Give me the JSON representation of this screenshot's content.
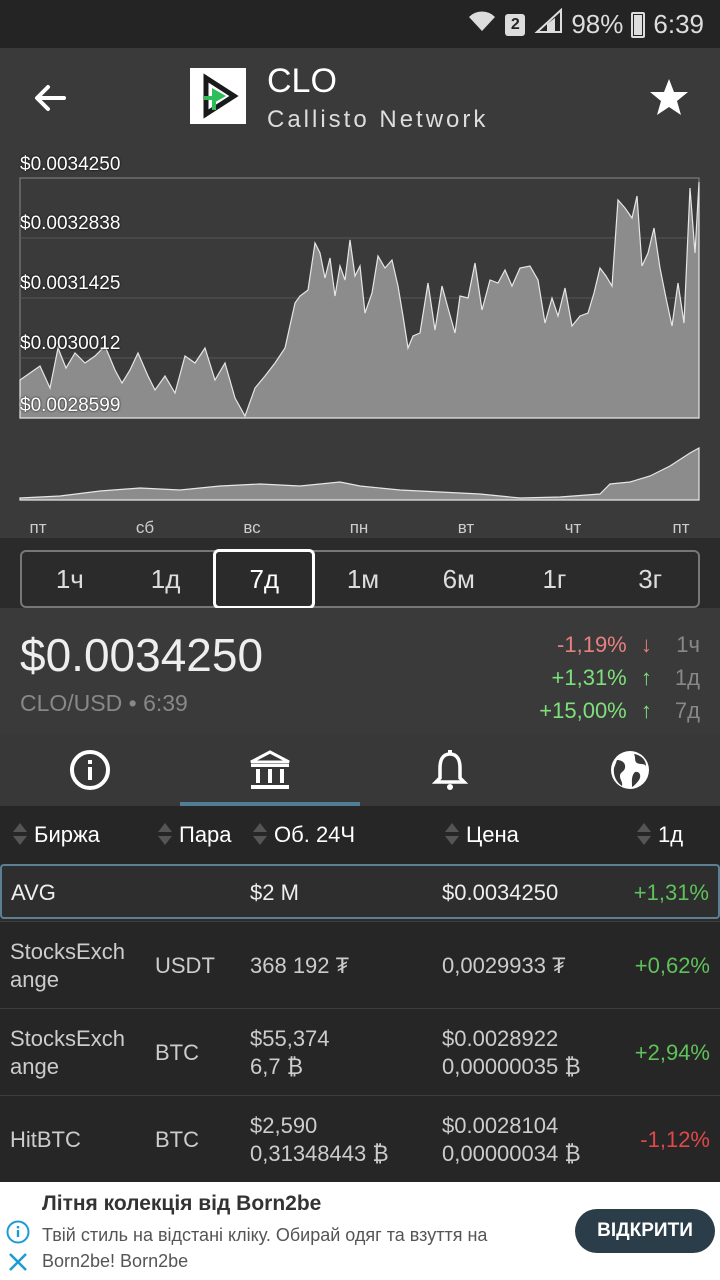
{
  "status": {
    "battery": "98%",
    "time": "6:39",
    "sim": "2"
  },
  "header": {
    "symbol": "CLO",
    "name": "Callisto Network"
  },
  "chart": {
    "y_labels": [
      "$0.0034250",
      "$0.0032838",
      "$0.0031425",
      "$0.0030012",
      "$0.0028599"
    ],
    "x_labels": [
      "пт",
      "сб",
      "вс",
      "пн",
      "вт",
      "чт",
      "пт"
    ]
  },
  "periods": [
    "1ч",
    "1д",
    "7д",
    "1м",
    "6м",
    "1г",
    "3г"
  ],
  "selected_period": "7д",
  "price": {
    "value": "$0.0034250",
    "pair_time": "CLO/USD • 6:39"
  },
  "changes": [
    {
      "value": "-1,19%",
      "arrow": "↓",
      "period": "1ч",
      "color": "#e88080"
    },
    {
      "value": "+1,31%",
      "arrow": "↑",
      "period": "1д",
      "color": "#7ee07a"
    },
    {
      "value": "+15,00%",
      "arrow": "↑",
      "period": "7д",
      "color": "#7ee07a"
    }
  ],
  "table": {
    "headers": {
      "exchange": "Биржа",
      "pair": "Пара",
      "volume": "Об. 24Ч",
      "price": "Цена",
      "change": "1д"
    },
    "avg": {
      "exchange": "AVG",
      "volume": "$2 M",
      "price": "$0.0034250",
      "change": "+1,31%"
    },
    "rows": [
      {
        "exchange1": "StocksExch",
        "exchange2": "ange",
        "pair": "USDT",
        "vol1": "368 192 ₮",
        "vol2": "",
        "price1": "0,0029933 ₮",
        "price2": "",
        "change": "+0,62%"
      },
      {
        "exchange1": "StocksExch",
        "exchange2": "ange",
        "pair": "BTC",
        "vol1": "$55,374",
        "vol2": "6,7 ₿",
        "price1": "$0.0028922",
        "price2": "0,00000035 ₿",
        "change": "+2,94%"
      },
      {
        "exchange1": "HitBTC",
        "exchange2": "",
        "pair": "BTC",
        "vol1": "$2,590",
        "vol2": "0,31348443 ₿",
        "price1": "$0.0028104",
        "price2": "0,00000034 ₿",
        "change": "-1,12%"
      }
    ]
  },
  "ad": {
    "title": "Літня колекція від Born2be",
    "text": "Твій стиль на відстані кліку. Обирай одяг та взуття на Born2be! Born2be",
    "button": "ВІДКРИТИ"
  }
}
